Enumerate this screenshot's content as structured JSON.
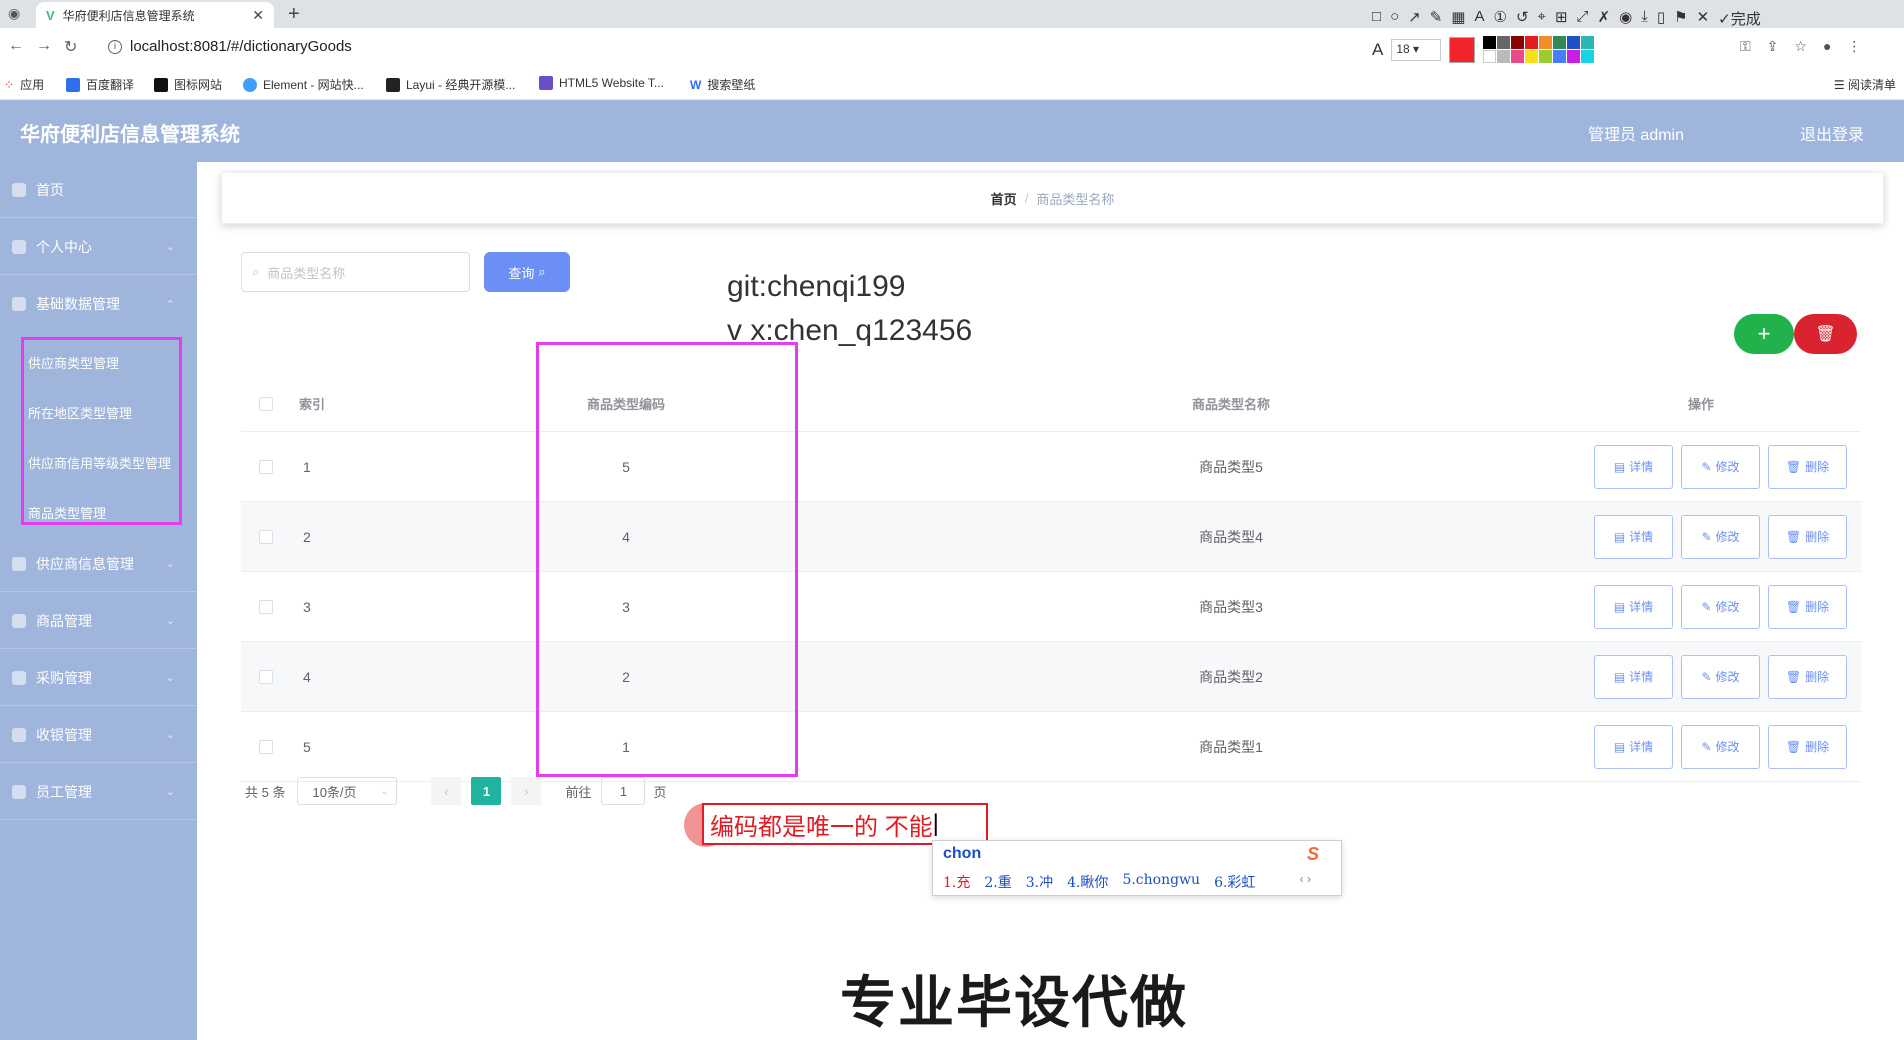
{
  "browser": {
    "tab_title": "华府便利店信息管理系统",
    "url": "localhost:8081/#/dictionaryGoods",
    "bookmarks": [
      "应用",
      "百度翻译",
      "图标网站",
      "Element - 网站快...",
      "Layui - 经典开源模...",
      "HTML5 Website T...",
      "搜索壁纸"
    ],
    "reading_list": "阅读清单",
    "toolbar_done": "完成",
    "font_size": "18"
  },
  "app": {
    "title": "华府便利店信息管理系统",
    "user": "管理员 admin",
    "logout": "退出登录"
  },
  "sidebar": {
    "items": [
      {
        "label": "首页"
      },
      {
        "label": "个人中心"
      },
      {
        "label": "基础数据管理"
      },
      {
        "label": "供应商信息管理"
      },
      {
        "label": "商品管理"
      },
      {
        "label": "采购管理"
      },
      {
        "label": "收银管理"
      },
      {
        "label": "员工管理"
      }
    ],
    "submenu": [
      {
        "label": "供应商类型管理"
      },
      {
        "label": "所在地区类型管理"
      },
      {
        "label": "供应商信用等级类型管理"
      },
      {
        "label": "商品类型管理"
      }
    ]
  },
  "breadcrumb": {
    "home": "首页",
    "separator": "/",
    "current": "商品类型名称"
  },
  "search": {
    "placeholder": "商品类型名称",
    "button": "查询"
  },
  "overlay": {
    "line1": "git:chenqi199",
    "line2": "v x:chen_q123456"
  },
  "table": {
    "headers": {
      "index": "索引",
      "code": "商品类型编码",
      "name": "商品类型名称",
      "ops": "操作"
    },
    "rows": [
      {
        "index": "1",
        "code": "5",
        "name": "商品类型5"
      },
      {
        "index": "2",
        "code": "4",
        "name": "商品类型4"
      },
      {
        "index": "3",
        "code": "3",
        "name": "商品类型3"
      },
      {
        "index": "4",
        "code": "2",
        "name": "商品类型2"
      },
      {
        "index": "5",
        "code": "1",
        "name": "商品类型1"
      }
    ],
    "ops": {
      "detail": "详情",
      "edit": "修改",
      "delete": "删除"
    }
  },
  "pagination": {
    "total": "共 5 条",
    "size": "10条/页",
    "current": "1",
    "goto": "前往",
    "goto_value": "1",
    "page_unit": "页"
  },
  "annotation": {
    "text": "编码都是唯一的 不能"
  },
  "ime": {
    "input": "chon",
    "candidates": [
      "1.充",
      "2.重",
      "3.冲",
      "4.瞅你",
      "5.chongwu",
      "6.彩虹"
    ]
  },
  "banner": "专业毕设代做",
  "colors": {
    "header_bg": "#9fb5dc",
    "primary": "#6b8ff5",
    "success": "#22b24c",
    "danger": "#d9232f",
    "highlight": "#e23df0",
    "annotation": "#e41b23"
  }
}
